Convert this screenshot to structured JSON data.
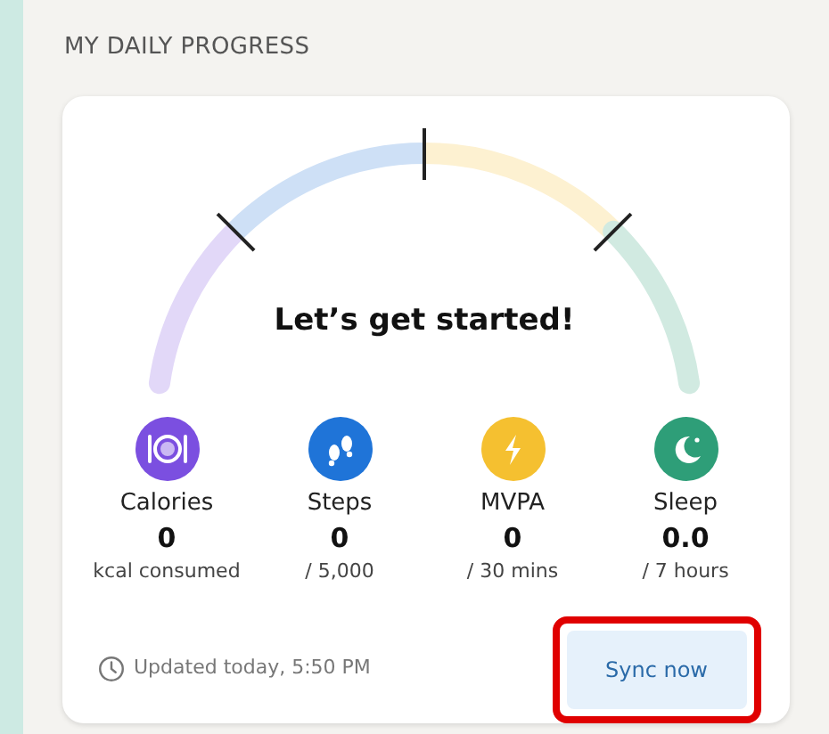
{
  "section_title": "MY DAILY PROGRESS",
  "gauge": {
    "message": "Let’s get started!"
  },
  "metrics": [
    {
      "kind": "calories",
      "label": "Calories",
      "value": "0",
      "target": "kcal consumed",
      "color": "#7b4fe0"
    },
    {
      "kind": "steps",
      "label": "Steps",
      "value": "0",
      "target": "/ 5,000",
      "color": "#1f74d8"
    },
    {
      "kind": "mvpa",
      "label": "MVPA",
      "value": "0",
      "target": "/ 30 mins",
      "color": "#f5c030"
    },
    {
      "kind": "sleep",
      "label": "Sleep",
      "value": "0.0",
      "target": "/ 7 hours",
      "color": "#2e9e78"
    }
  ],
  "updated": "Updated today, 5:50 PM",
  "sync_button": {
    "label": "Sync now",
    "highlighted": true
  }
}
